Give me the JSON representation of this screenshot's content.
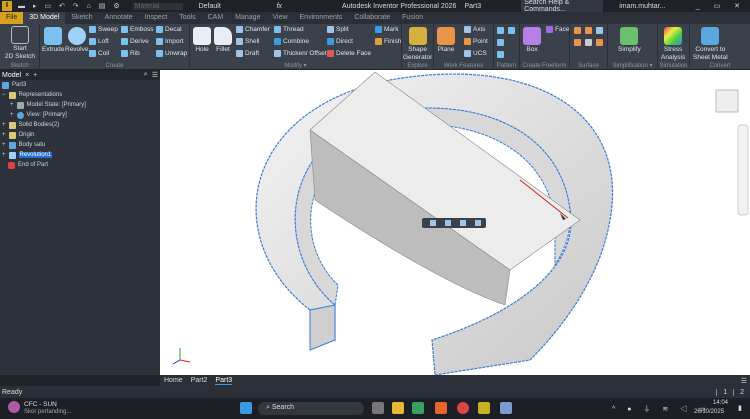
{
  "titlebar": {
    "material": "Material",
    "appearance": "Default",
    "title": "Autodesk Inventor Professional 2026",
    "doc": "Part3",
    "search": "Search Help & Commands...",
    "user": "imam.muhtar..."
  },
  "tabs": [
    "File",
    "3D Model",
    "Sketch",
    "Annotate",
    "Inspect",
    "Tools",
    "CAM",
    "Manage",
    "View",
    "Environments",
    "Collaborate",
    "Fusion"
  ],
  "ribbon": {
    "sketch": {
      "label": "Sketch",
      "start": "Start",
      "start2": "2D Sketch"
    },
    "create": {
      "label": "Create",
      "extrude": "Extrude",
      "revolve": "Revolve",
      "sweep": "Sweep",
      "loft": "Loft",
      "coil": "Coil",
      "emboss": "Emboss",
      "derive": "Derive",
      "rib": "Rib",
      "decal": "Decal",
      "import": "Import",
      "unwrap": "Unwrap"
    },
    "modify": {
      "label": "Modify ▾",
      "hole": "Hole",
      "fillet": "Fillet",
      "chamfer": "Chamfer",
      "shell": "Shell",
      "draft": "Draft",
      "thread": "Thread",
      "combine": "Combine",
      "thicken": "Thicken/ Offset",
      "split": "Split",
      "direct": "Direct",
      "delete_face": "Delete Face",
      "mark": "Mark",
      "finish": "Finish"
    },
    "explore": {
      "label": "Explore",
      "shape": "Shape",
      "generator": "Generator"
    },
    "work": {
      "label": "Work Features",
      "plane": "Plane",
      "axis": "Axis",
      "point": "Point",
      "ucs": "UCS"
    },
    "pattern": {
      "label": "Pattern"
    },
    "freeform": {
      "label": "Create Freeform",
      "box": "Box",
      "face": "Face"
    },
    "surface": {
      "label": "Surface"
    },
    "simplification": {
      "label": "Simplification ▾",
      "simplify": "Simplify"
    },
    "simulation": {
      "label": "Simulation",
      "stress": "Stress",
      "analysis": "Analysis"
    },
    "convert": {
      "label": "Convert",
      "c1": "Convert to",
      "c2": "Sheet Metal"
    }
  },
  "browser": {
    "tab": "Model",
    "nodes": [
      "Part3",
      "Representations",
      "Model State: [Primary]",
      "View: [Primary]",
      "Solid Bodies(2)",
      "Origin",
      "Body satu",
      "Revolution1",
      "End of Part"
    ]
  },
  "doctabs": [
    "Home",
    "Part2",
    "Part3"
  ],
  "status": {
    "text": "Ready",
    "pages": [
      "1",
      "2"
    ]
  },
  "taskbar": {
    "weather_title": "CFC - SUN",
    "weather_sub": "Skor pertanding...",
    "search": "Search",
    "time": "14:04",
    "date": "26/10/2025"
  },
  "colors": {
    "accent": "#d6a21e",
    "edge": "#3a7bd5",
    "selection": "#1f6fd0"
  }
}
